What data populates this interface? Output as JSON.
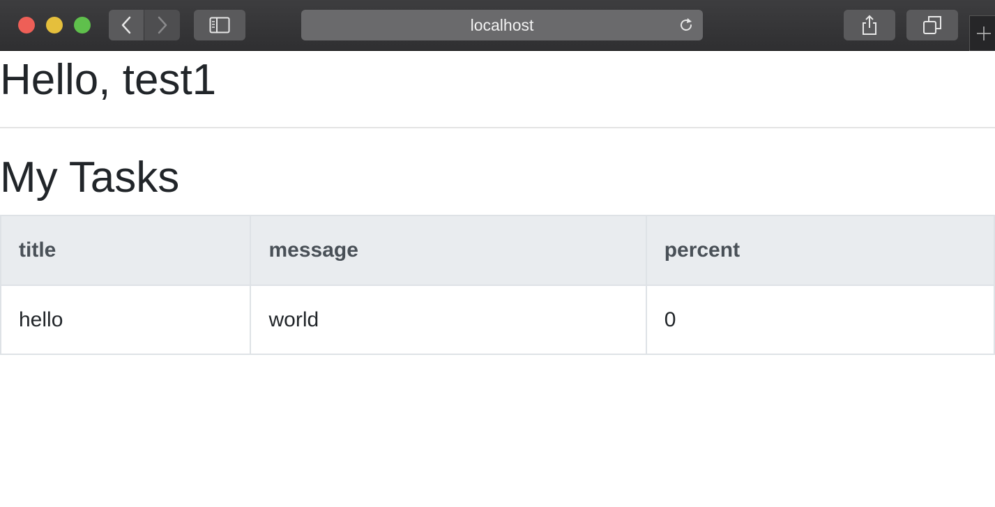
{
  "browser": {
    "url": "localhost",
    "icons": {
      "back": "chevron-left-icon",
      "forward": "chevron-right-icon",
      "sidebar": "sidebar-icon",
      "reload": "reload-icon",
      "share": "share-icon",
      "tabs": "tabs-overview-icon",
      "new_tab": "plus-icon"
    }
  },
  "page": {
    "greeting": "Hello, test1",
    "section_title": "My Tasks"
  },
  "table": {
    "headers": [
      "title",
      "message",
      "percent"
    ],
    "rows": [
      [
        "hello",
        "world",
        "0"
      ]
    ]
  },
  "colors": {
    "titlebar": "#38383a",
    "text": "#212529",
    "header_bg": "#e9ecef",
    "border": "#dee2e6"
  }
}
